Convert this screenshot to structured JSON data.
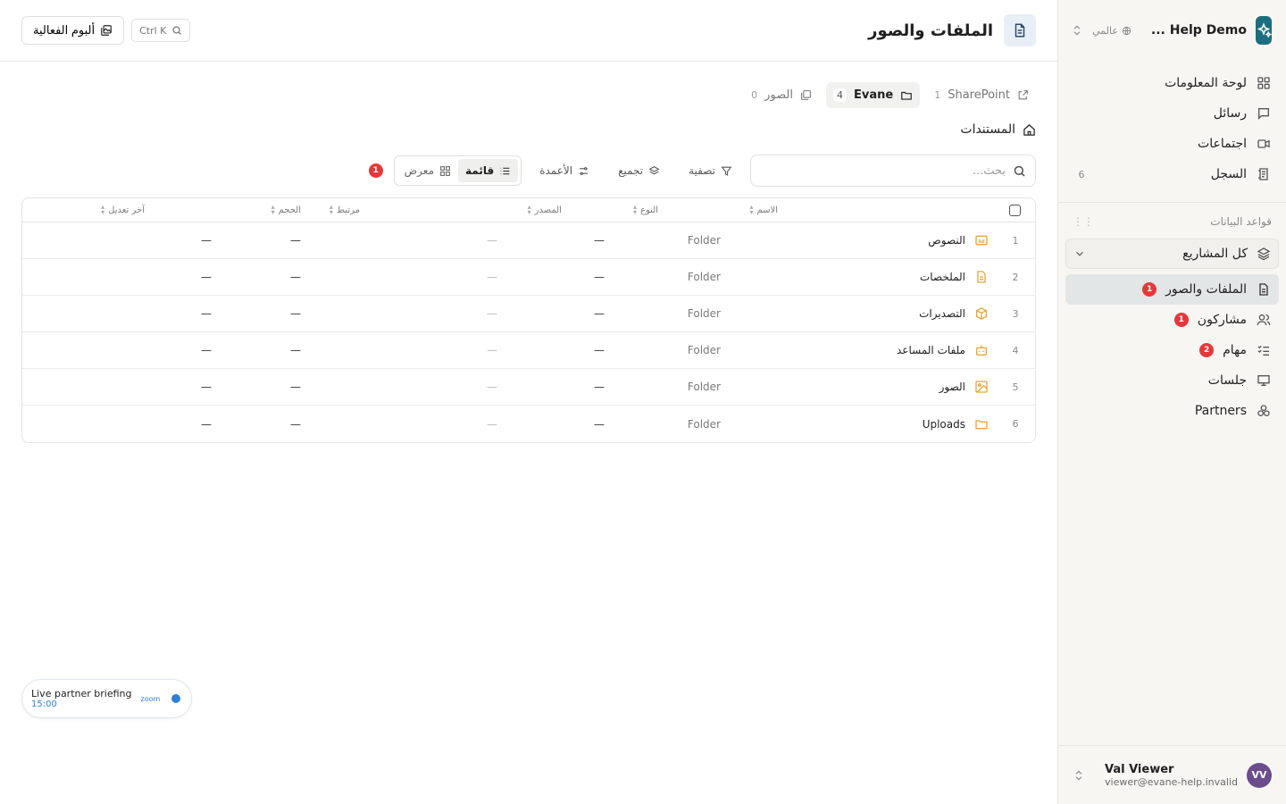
{
  "workspace": {
    "name": "Help Demo ...",
    "scope": "عالمي"
  },
  "nav": [
    {
      "label": "لوحة المعلومات",
      "icon": "dashboard-icon"
    },
    {
      "label": "رسائل",
      "icon": "message-icon"
    },
    {
      "label": "اجتماعات",
      "icon": "video-icon"
    },
    {
      "label": "السجل",
      "icon": "log-icon",
      "count": "6"
    }
  ],
  "databases": {
    "label": "قواعد البيانات",
    "project_selector": "كل المشاريع",
    "items": [
      {
        "label": "الملفات والصور",
        "icon": "file-icon",
        "badge": "1",
        "active": true
      },
      {
        "label": "مشاركون",
        "icon": "users-icon",
        "badge": "1"
      },
      {
        "label": "مهام",
        "icon": "tasks-icon",
        "badge": "2"
      },
      {
        "label": "جلسات",
        "icon": "presentation-icon"
      },
      {
        "label": "Partners",
        "icon": "partners-icon"
      }
    ]
  },
  "user": {
    "name": "Val Viewer",
    "email": "viewer@evane-help.invalid",
    "initials": "VV"
  },
  "header": {
    "title": "الملفات والصور",
    "shortcut": "Ctrl K",
    "album_button": "ألبوم الفعالية"
  },
  "source_tabs": [
    {
      "label": "SharePoint",
      "count": "1",
      "icon": "external-link-icon"
    },
    {
      "label": "Evane",
      "count": "4",
      "icon": "folder-icon",
      "active": true
    },
    {
      "label": "الصور",
      "count": "0",
      "icon": "images-icon"
    }
  ],
  "breadcrumb": {
    "label": "المستندات"
  },
  "toolbar": {
    "search_placeholder": "بحث...",
    "filter": "تصفية",
    "group": "تجميع",
    "columns": "الأعمدة",
    "view_list": "قائمة",
    "view_gallery": "معرض",
    "badge": "1"
  },
  "table": {
    "headers": {
      "name": "الاسم",
      "type": "النوع",
      "source": "المصدر",
      "linked": "مرتبط",
      "size": "الحجم",
      "modified": "آخر تعديل"
    },
    "rows": [
      {
        "idx": "1",
        "name": "النصوص",
        "icon": "subtitles-icon",
        "type": "Folder",
        "source": "—",
        "linked": "—",
        "size": "—",
        "modified": "—"
      },
      {
        "idx": "2",
        "name": "الملخصات",
        "icon": "document-icon",
        "type": "Folder",
        "source": "—",
        "linked": "—",
        "size": "—",
        "modified": "—"
      },
      {
        "idx": "3",
        "name": "التصديرات",
        "icon": "package-icon",
        "type": "Folder",
        "source": "—",
        "linked": "—",
        "size": "—",
        "modified": "—"
      },
      {
        "idx": "4",
        "name": "ملفات المساعد",
        "icon": "bot-icon",
        "type": "Folder",
        "source": "—",
        "linked": "—",
        "size": "—",
        "modified": "—"
      },
      {
        "idx": "5",
        "name": "الصور",
        "icon": "image-icon",
        "type": "Folder",
        "source": "—",
        "linked": "—",
        "size": "—",
        "modified": "—"
      },
      {
        "idx": "6",
        "name": "Uploads",
        "icon": "folder-icon",
        "type": "Folder",
        "source": "—",
        "linked": "—",
        "size": "—",
        "modified": "—"
      }
    ]
  },
  "floating": {
    "title": "Live partner briefing",
    "time": "15:00",
    "provider": "zoom"
  },
  "colors": {
    "accent": "#1c6e7f",
    "badge": "#e5383b",
    "folder_icon": "#e8a53a",
    "link": "#2f7fd8"
  }
}
